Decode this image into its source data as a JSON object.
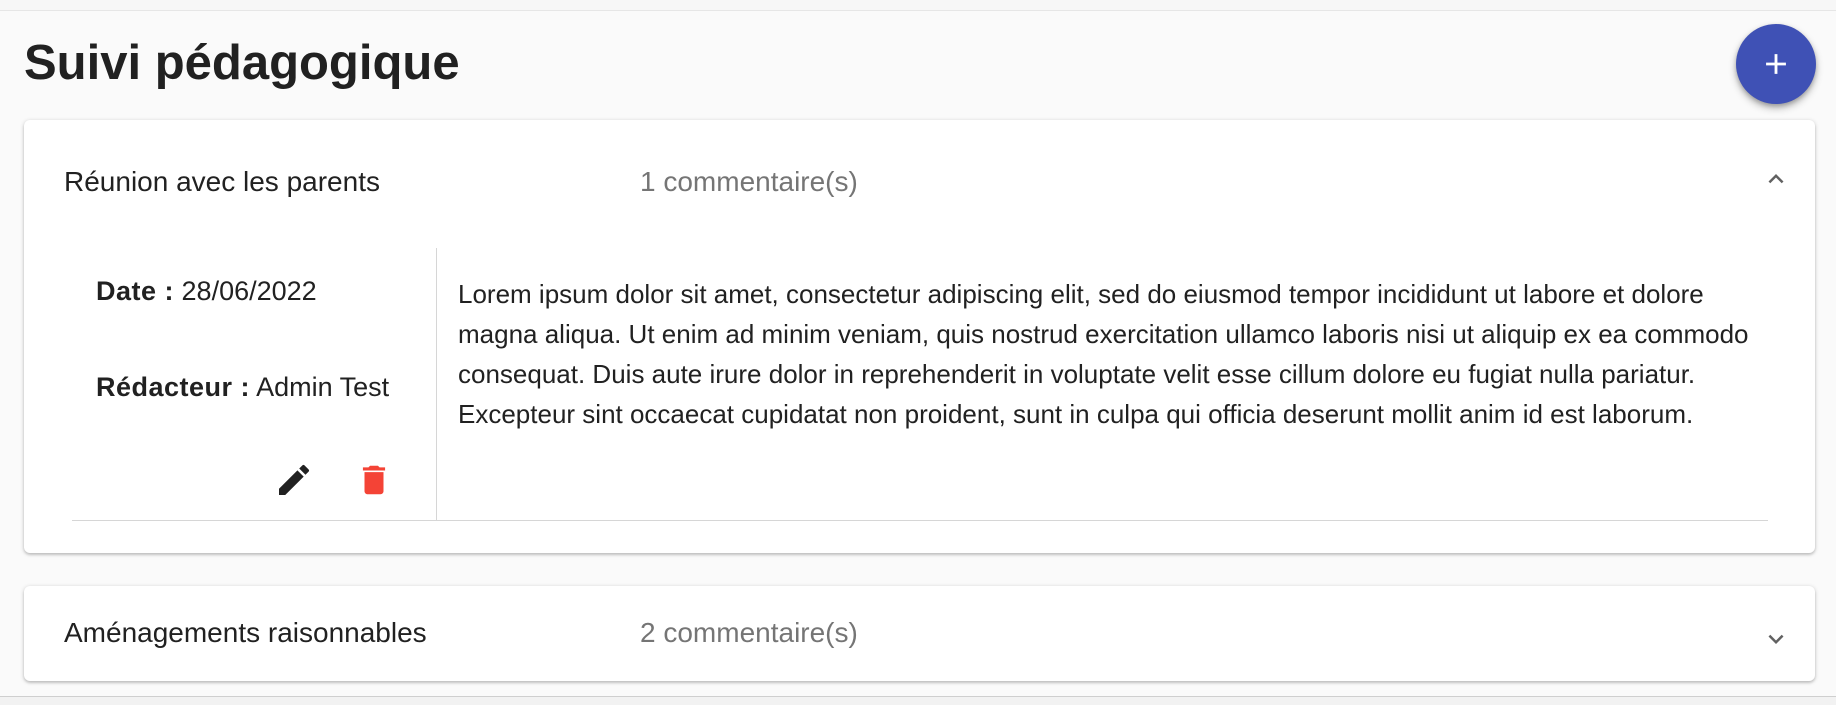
{
  "page": {
    "title": "Suivi pédagogique",
    "add_button_icon": "plus-icon",
    "accent_color": "#3f51b5"
  },
  "panels": [
    {
      "title": "Réunion avec les parents",
      "count": "1 commentaire(s)",
      "expanded": true,
      "chevron_icon": "chevron-up-icon",
      "comments": [
        {
          "date_label": "Date :",
          "date": "28/06/2022",
          "author_label": "Rédacteur :",
          "author": "Admin Test",
          "text": "Lorem ipsum dolor sit amet, consectetur adipiscing elit, sed do eiusmod tempor incididunt ut labore et dolore magna aliqua. Ut enim ad minim veniam, quis nostrud exercitation ullamco laboris nisi ut aliquip ex ea commodo consequat. Duis aute irure dolor in reprehenderit in voluptate velit esse cillum dolore eu fugiat nulla pariatur. Excepteur sint occaecat cupidatat non proident, sunt in culpa qui officia deserunt mollit anim id est laborum.",
          "edit_icon": "pencil-icon",
          "delete_icon": "trash-icon",
          "delete_color": "#f44336"
        }
      ]
    },
    {
      "title": "Aménagements raisonnables",
      "count": "2 commentaire(s)",
      "expanded": false,
      "chevron_icon": "chevron-down-icon"
    }
  ]
}
